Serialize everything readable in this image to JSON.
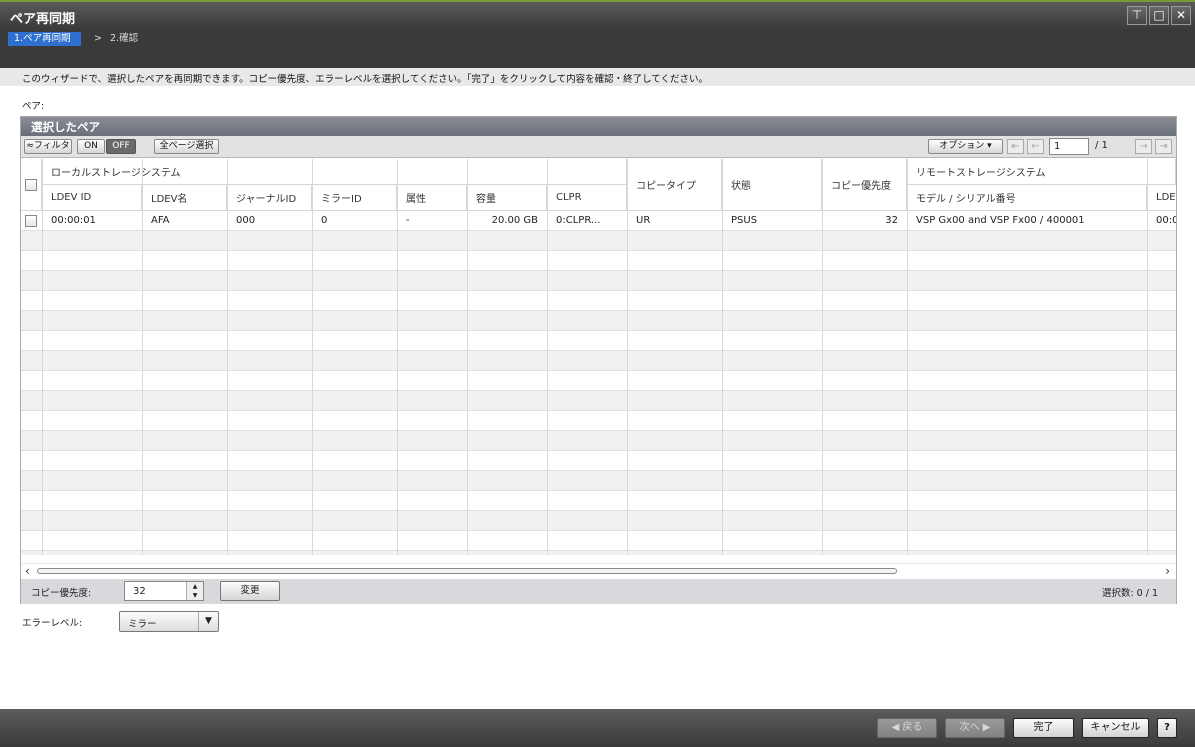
{
  "window": {
    "title": "ペア再同期",
    "icons": [
      "pin-icon",
      "maximize-icon",
      "close-icon"
    ]
  },
  "steps": {
    "step1": "1.ペア再同期",
    "sep": ">",
    "step2": "2.確認"
  },
  "description": "このウィザードで、選択したペアを再同期できます。コピー優先度、エラーレベルを選択してください。「完了」をクリックして内容を確認・終了してください。",
  "pair_label": "ペア:",
  "panel": {
    "title": "選択したペア",
    "toolbar": {
      "filter": "≈フィルタ",
      "on": "ON",
      "off": "OFF",
      "select_all": "全ページ選択",
      "options": "オプション ▾",
      "page": "1",
      "page_total": "/ 1"
    },
    "group_headers": {
      "local": "ローカルストレージシステム",
      "remote": "リモートストレージシステム"
    },
    "columns": {
      "ldev_id": "LDEV ID",
      "ldev_name": "LDEV名",
      "journal_id": "ジャーナルID",
      "mirror_id": "ミラーID",
      "attribute": "属性",
      "capacity": "容量",
      "clpr": "CLPR",
      "copy_type": "コピータイプ",
      "status": "状態",
      "copy_priority": "コピー優先度",
      "model_serial": "モデル / シリアル番号",
      "remote_ldev": "LDEV"
    },
    "rows": [
      {
        "ldev_id": "00:00:01",
        "ldev_name": "AFA",
        "journal_id": "000",
        "mirror_id": "0",
        "attribute": "-",
        "capacity": "20.00 GB",
        "clpr": "0:CLPR...",
        "copy_type": "UR",
        "status": "PSUS",
        "copy_priority": "32",
        "model_serial": "VSP Gx00 and VSP Fx00 / 400001",
        "remote_ldev": "00:0"
      }
    ]
  },
  "priority": {
    "label": "コピー優先度:",
    "value": "32",
    "change": "変更",
    "selected": "選択数:  0    /    1"
  },
  "error_level": {
    "label": "エラーレベル:",
    "value": "ミラー"
  },
  "footer": {
    "back": "◀ 戻る",
    "next": "次へ ▶",
    "finish": "完了",
    "cancel": "キャンセル",
    "help": "?"
  }
}
